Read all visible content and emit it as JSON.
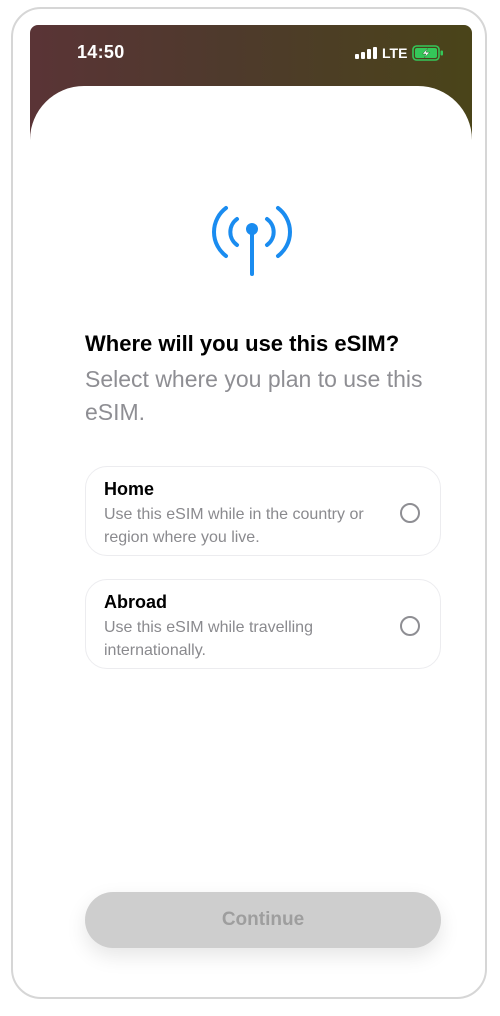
{
  "status_bar": {
    "time": "14:50",
    "network": "LTE",
    "icons": [
      "signal-bars-icon",
      "battery-charging-icon"
    ]
  },
  "header": {
    "icon": "antenna-signal-icon",
    "title": "Where will you use this eSIM?",
    "subtitle": "Select where you plan to use this eSIM."
  },
  "options": [
    {
      "title": "Home",
      "description": "Use this eSIM while in the country or region where you live.",
      "selected": false
    },
    {
      "title": "Abroad",
      "description": "Use this eSIM while travelling internationally.",
      "selected": false
    }
  ],
  "footer": {
    "continue_label": "Continue",
    "continue_enabled": false
  },
  "colors": {
    "accent": "#1a8cf0",
    "disabled_button": "#cecece",
    "battery": "#34c759"
  }
}
